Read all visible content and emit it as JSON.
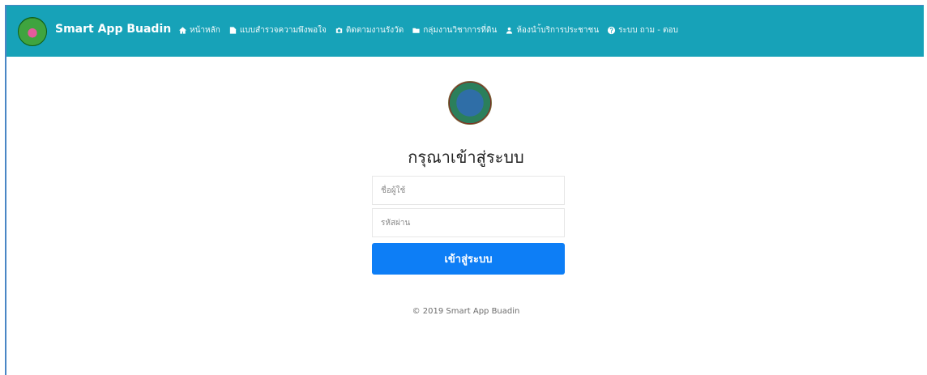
{
  "navbar": {
    "brand": "Smart App Buadin",
    "items": [
      {
        "label": "หน้าหลัก",
        "icon": "home-icon"
      },
      {
        "label": "แบบสำรวจความพึงพอใจ",
        "icon": "document-icon"
      },
      {
        "label": "ติดตามงานรังวัด",
        "icon": "camera-icon"
      },
      {
        "label": "กลุ่มงานวิชาการที่ดิน",
        "icon": "folder-icon"
      },
      {
        "label": "ห้องนำ้บริการประชาชน",
        "icon": "user-icon"
      },
      {
        "label": "ระบบ ถาม - ตอบ",
        "icon": "question-icon"
      }
    ]
  },
  "login": {
    "title": "กรุณาเข้าสู่ระบบ",
    "username_placeholder": "ชื่อผู้ใช้",
    "password_placeholder": "รหัสผ่าน",
    "submit_label": "เข้าสู่ระบบ"
  },
  "footer": {
    "text": "© 2019 Smart App Buadin"
  },
  "colors": {
    "navbar_bg": "#17a2b8",
    "button_bg": "#0d7ef6"
  }
}
